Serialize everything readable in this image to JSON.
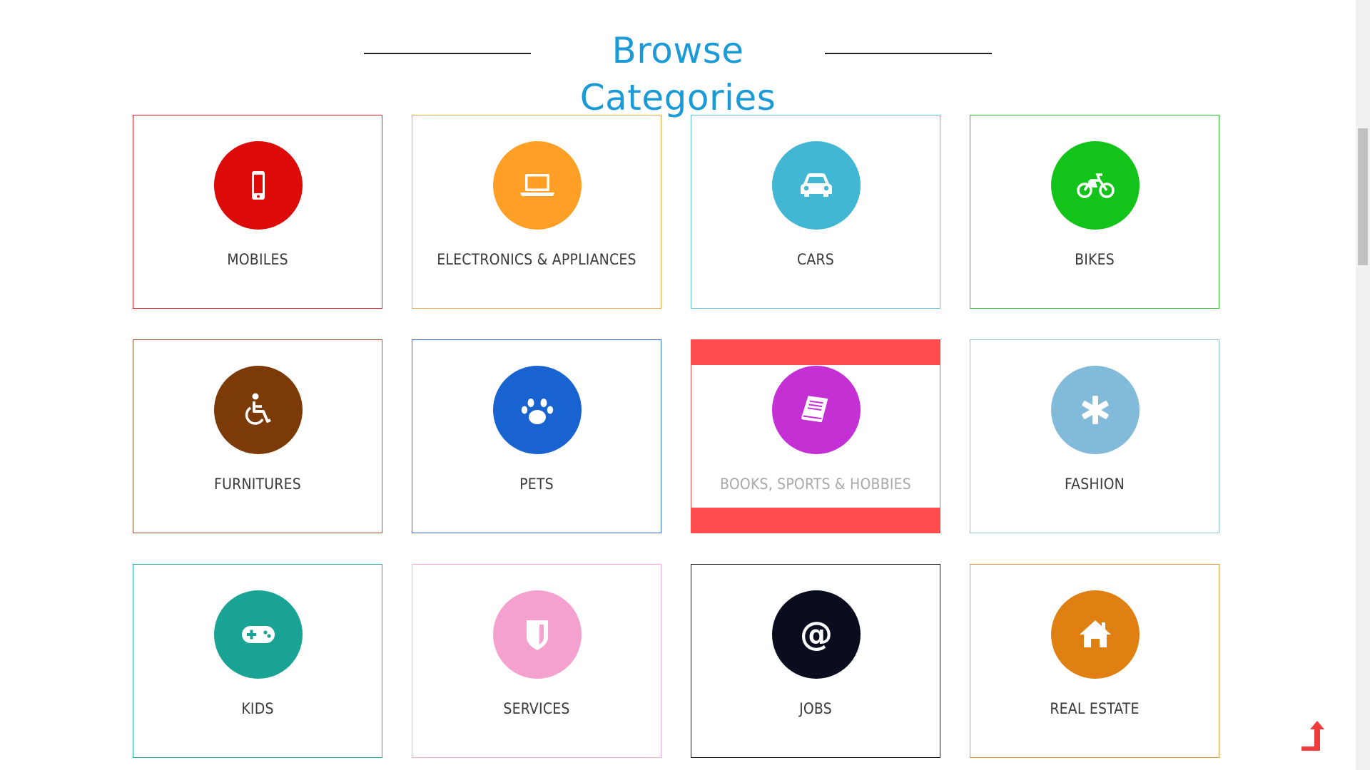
{
  "section": {
    "title": "Browse Categories"
  },
  "colors": {
    "title": "#1a9ad6",
    "hover_band": "#ff4d4f",
    "label": "#3a3a3a",
    "label_hover": "#a9a9a9",
    "back_to_top": "#f03c3c"
  },
  "categories": [
    {
      "label": "MOBILES",
      "icon": "mobile-icon",
      "color": "#dd0a0a",
      "border": "#e0212b"
    },
    {
      "label": "ELECTRONICS & APPLIANCES",
      "icon": "laptop-icon",
      "color": "#ff9f25",
      "border": "#f0a94a"
    },
    {
      "label": "CARS",
      "icon": "car-icon",
      "color": "#41b7d4",
      "border": "#5fc4dc"
    },
    {
      "label": "BIKES",
      "icon": "bicycle-icon",
      "color": "#12c41a",
      "border": "#2fbf35"
    },
    {
      "label": "FURNITURES",
      "icon": "wheelchair-icon",
      "color": "#7b3a07",
      "border": "#a0522d"
    },
    {
      "label": "PETS",
      "icon": "paw-icon",
      "color": "#1863cf",
      "border": "#2f6fd0"
    },
    {
      "label": "BOOKS, SPORTS & HOBBIES",
      "icon": "book-icon",
      "color": "#c330d4",
      "border": "#ff4d4f",
      "hovered": true
    },
    {
      "label": "FASHION",
      "icon": "asterisk-icon",
      "color": "#82bbd9",
      "border": "#8cc1de"
    },
    {
      "label": "KIDS",
      "icon": "gamepad-icon",
      "color": "#19a395",
      "border": "#28b0a3"
    },
    {
      "label": "SERVICES",
      "icon": "shield-icon",
      "color": "#f4a1cf",
      "border": "#f7a8d4"
    },
    {
      "label": "JOBS",
      "icon": "at-icon",
      "color": "#0a0d1e",
      "border": "#1a1a1a"
    },
    {
      "label": "REAL ESTATE",
      "icon": "home-icon",
      "color": "#e08012",
      "border": "#e89640"
    }
  ],
  "back_to_top": {
    "icon": "arrow-up-icon"
  }
}
